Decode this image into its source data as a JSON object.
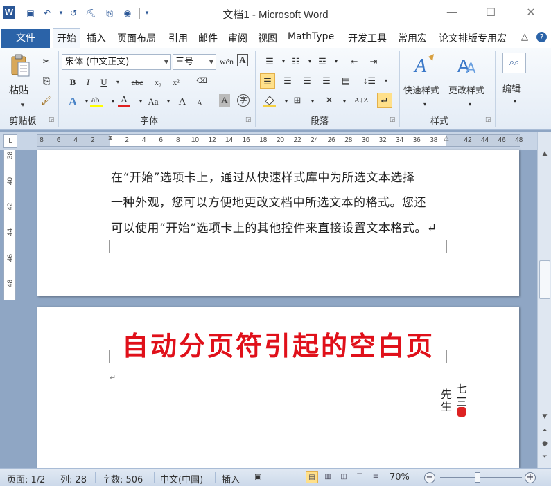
{
  "window": {
    "title": "文档1 - Microsoft Word",
    "logo_letter": "W",
    "min_symbol": "—",
    "max_symbol": "☐",
    "close_symbol": "✕"
  },
  "quick_access": [
    {
      "name": "save-icon",
      "glyph": "▣"
    },
    {
      "name": "undo-icon",
      "glyph": "↶"
    },
    {
      "name": "undo-dropdown-icon",
      "glyph": "▾"
    },
    {
      "name": "redo-icon",
      "glyph": "↺"
    },
    {
      "name": "format-painter-qa-icon",
      "glyph": "⛏"
    },
    {
      "name": "clipboard-qa-icon",
      "glyph": "⎘"
    },
    {
      "name": "info-icon",
      "glyph": "◉"
    },
    {
      "name": "customize-qa-icon",
      "glyph": "▾"
    }
  ],
  "tabs": {
    "file": "文件",
    "items": [
      "开始",
      "插入",
      "页面布局",
      "引用",
      "邮件",
      "审阅",
      "视图",
      "MathType",
      "开发工具",
      "常用宏",
      "论文排版专用宏"
    ],
    "active_index": 0,
    "collapse_symbol": "△",
    "help_symbol": "?"
  },
  "ribbon": {
    "clipboard": {
      "label": "剪贴板",
      "paste_label": "粘贴"
    },
    "font": {
      "label": "字体",
      "font_name": "宋体 (中文正文)",
      "font_size": "三号",
      "bold": "B",
      "italic": "I",
      "underline": "U",
      "strikethrough": "abc",
      "subscript": "x₂",
      "superscript": "x²",
      "change_case": "Aa",
      "grow_font": "A",
      "shrink_font": "A"
    },
    "paragraph": {
      "label": "段落"
    },
    "styles": {
      "label": "样式",
      "quick_styles": "快速样式",
      "change_styles": "更改样式"
    },
    "editing": {
      "label": "编辑",
      "edit_label": "编辑"
    }
  },
  "ruler": {
    "numbers": [
      "8",
      "6",
      "4",
      "2",
      "",
      "2",
      "4",
      "6",
      "8",
      "10",
      "12",
      "14",
      "16",
      "18",
      "20",
      "22",
      "24",
      "26",
      "28",
      "30",
      "32",
      "34",
      "36",
      "38",
      "",
      "42",
      "44",
      "46",
      "48"
    ],
    "vertical_numbers": [
      "38",
      "40",
      "42",
      "44",
      "46",
      "48"
    ],
    "corner": "L"
  },
  "document": {
    "page1_lines": [
      "在“开始”选项卡上，通过从快速样式库中为所选文本选择",
      "一种外观，您可以方便地更改文档中所选文本的格式。您还",
      "可以使用“开始”选项卡上的其他控件来直接设置文本格式。↵"
    ],
    "page2_heading": "自动分页符引起的空白页",
    "paragraph_mark": "↵",
    "stamp_chars": [
      "七",
      "三",
      "先",
      "生"
    ]
  },
  "statusbar": {
    "page": "页面: 1/2",
    "column": "列: 28",
    "word_count": "字数: 506",
    "language": "中文(中国)",
    "insert_mode": "插入",
    "zoom": "70%",
    "zoom_minus": "−",
    "zoom_plus": "+",
    "zoom_level": 0.46
  }
}
